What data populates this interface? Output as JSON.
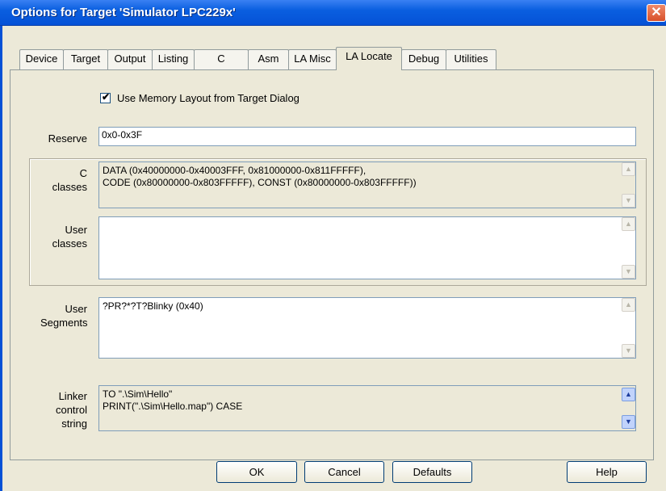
{
  "window": {
    "title": "Options for Target 'Simulator LPC229x'",
    "close_glyph": "✕"
  },
  "tabs": [
    {
      "label": "Device"
    },
    {
      "label": "Target"
    },
    {
      "label": "Output"
    },
    {
      "label": "Listing"
    },
    {
      "label": "C"
    },
    {
      "label": "Asm"
    },
    {
      "label": "LA Misc"
    },
    {
      "label": "LA Locate"
    },
    {
      "label": "Debug"
    },
    {
      "label": "Utilities"
    }
  ],
  "active_tab": "LA Locate",
  "use_memory_layout": {
    "label": "Use Memory Layout from Target Dialog",
    "checked": true,
    "glyph": "✔"
  },
  "reserve": {
    "label": "Reserve",
    "value": "0x0-0x3F"
  },
  "c_classes": {
    "label_line1": "C",
    "label_line2": "classes",
    "value": "DATA (0x40000000-0x40003FFF, 0x81000000-0x811FFFFF),\nCODE (0x80000000-0x803FFFFF), CONST (0x80000000-0x803FFFFF))"
  },
  "user_classes": {
    "label_line1": "User",
    "label_line2": "classes",
    "value": ""
  },
  "user_segments": {
    "label_line1": "User",
    "label_line2": "Segments",
    "value": "?PR?*?T?Blinky (0x40)"
  },
  "linker_control": {
    "label_line1": "Linker",
    "label_line2": "control",
    "label_line3": "string",
    "value": "TO \".\\Sim\\Hello\"\nPRINT(\".\\Sim\\Hello.map\") CASE"
  },
  "scroll": {
    "up_glyph": "▲",
    "down_glyph": "▼"
  },
  "buttons": {
    "ok": "OK",
    "cancel": "Cancel",
    "defaults": "Defaults",
    "help": "Help"
  }
}
